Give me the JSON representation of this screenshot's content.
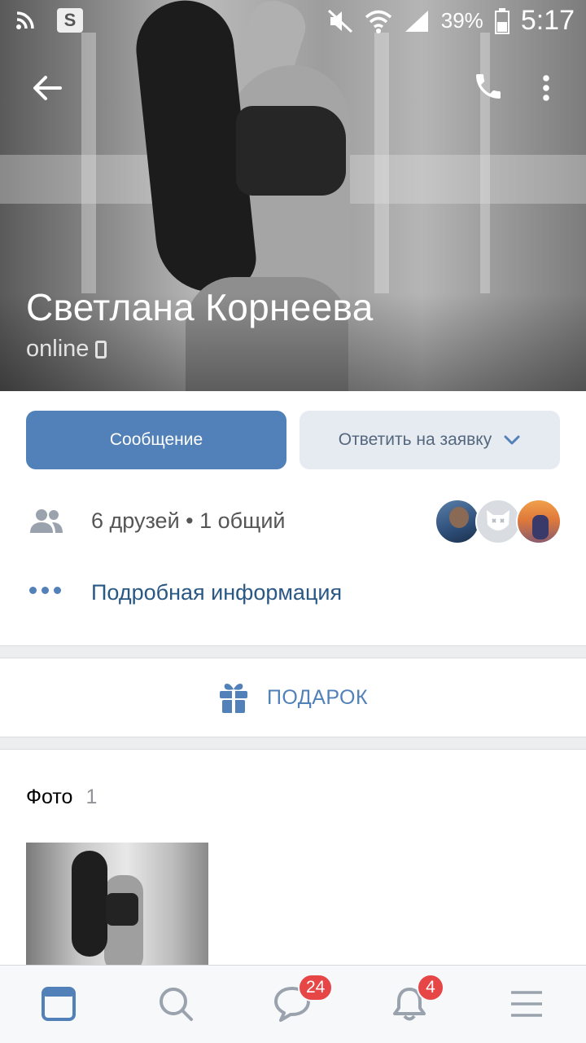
{
  "status_bar": {
    "battery": "39%",
    "time": "5:17",
    "icons": [
      "wifi-signal-icon",
      "s-app-icon",
      "muted-icon",
      "wifi-icon",
      "cell-signal-icon",
      "battery-icon"
    ]
  },
  "profile": {
    "name": "Светлана Корнеева",
    "status": "online"
  },
  "actions": {
    "message_label": "Сообщение",
    "reply_label": "Ответить на заявку"
  },
  "friends": {
    "text": "6 друзей • 1 общий"
  },
  "details": {
    "label": "Подробная информация"
  },
  "gift": {
    "label": "ПОДАРОК"
  },
  "photos": {
    "title": "Фото",
    "count": "1"
  },
  "bottom_nav": {
    "messages_badge": "24",
    "notifications_badge": "4"
  },
  "colors": {
    "accent": "#5181b8",
    "link": "#2a5885",
    "badge": "#e64646",
    "secondary_button": "#e5ebf1"
  }
}
